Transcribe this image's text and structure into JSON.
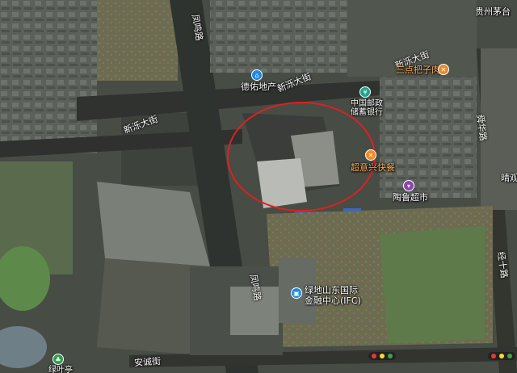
{
  "roads": {
    "xinluo_top": "新泺大街",
    "xinluo_left": "新泺大街",
    "xinluo_top2": "新泺大街",
    "fengming": "凤鸣路",
    "fengming_lower": "凤鸣路",
    "jingshi": "经十路",
    "anhe": "安诚街",
    "right_vertical": "舜华路"
  },
  "pois": {
    "guizhou_maotai": "贵州茅台",
    "deyou": "德佑地产",
    "sandianba": "三点把子肉",
    "china_post_line1": "中国邮政",
    "china_post_line2": "储蓄银行",
    "chaoyixing": "超意兴快餐",
    "taolu": "陶鲁超市",
    "ludi_line1": "绿地山东国际",
    "ludi_line2": "金融中心(IFC)",
    "qingjing": "晴观",
    "bottom_left": "绿叶亭"
  },
  "icons": {
    "deyou": "real-estate-pin-icon",
    "sandianba": "restaurant-pin-icon",
    "china_post": "bank-pin-icon",
    "chaoyixing": "fastfood-pin-icon",
    "taolu": "shopping-pin-icon",
    "ludi": "office-building-pin-icon",
    "bottom_left": "park-pin-icon"
  },
  "colors": {
    "highlight_circle": "#e02020",
    "poi_blue": "#1e88e5",
    "poi_orange": "#f08a24",
    "poi_purple": "#8e44ad",
    "poi_teal": "#1aa58c",
    "poi_green": "#2e9e4a"
  }
}
